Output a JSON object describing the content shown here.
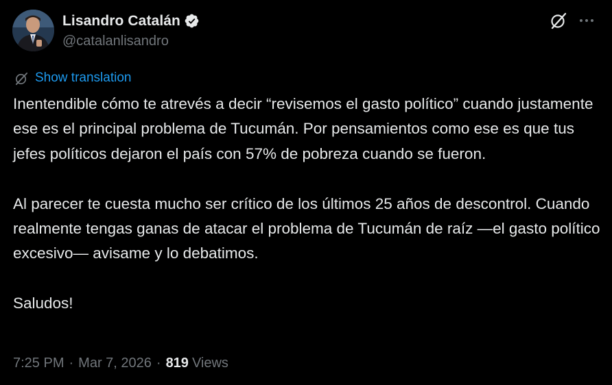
{
  "author": {
    "display_name": "Lisandro Catalán",
    "handle": "@catalanlisandro",
    "verified": true,
    "avatar_icon": "avatar-photo"
  },
  "actions": {
    "grok_icon": "grok-slash-icon",
    "more_icon": "more-dots-icon"
  },
  "translation": {
    "icon": "translate-globe-icon",
    "label": "Show translation"
  },
  "tweet": {
    "paragraphs": [
      "Inentendible cómo te atrevés a decir “revisemos el gasto político” cuando justamente ese es el principal problema de Tucumán. Por pensamientos como ese es que tus jefes políticos dejaron el país con 57% de pobreza cuando se fueron.",
      "Al parecer te cuesta mucho ser crítico de los últimos 25 años de descontrol. Cuando realmente tengas ganas de atacar el problema de Tucumán de raíz —el gasto político excesivo— avisame y lo debatimos.",
      "Saludos!"
    ]
  },
  "meta": {
    "time": "7:25 PM",
    "separator": "·",
    "date": "Mar 7, 2026",
    "views_count": "819",
    "views_label": "Views"
  },
  "colors": {
    "background": "#000000",
    "text_primary": "#e7e9ea",
    "text_secondary": "#71767b",
    "link": "#1d9bf0",
    "verified_badge": "#e7e9ea"
  }
}
